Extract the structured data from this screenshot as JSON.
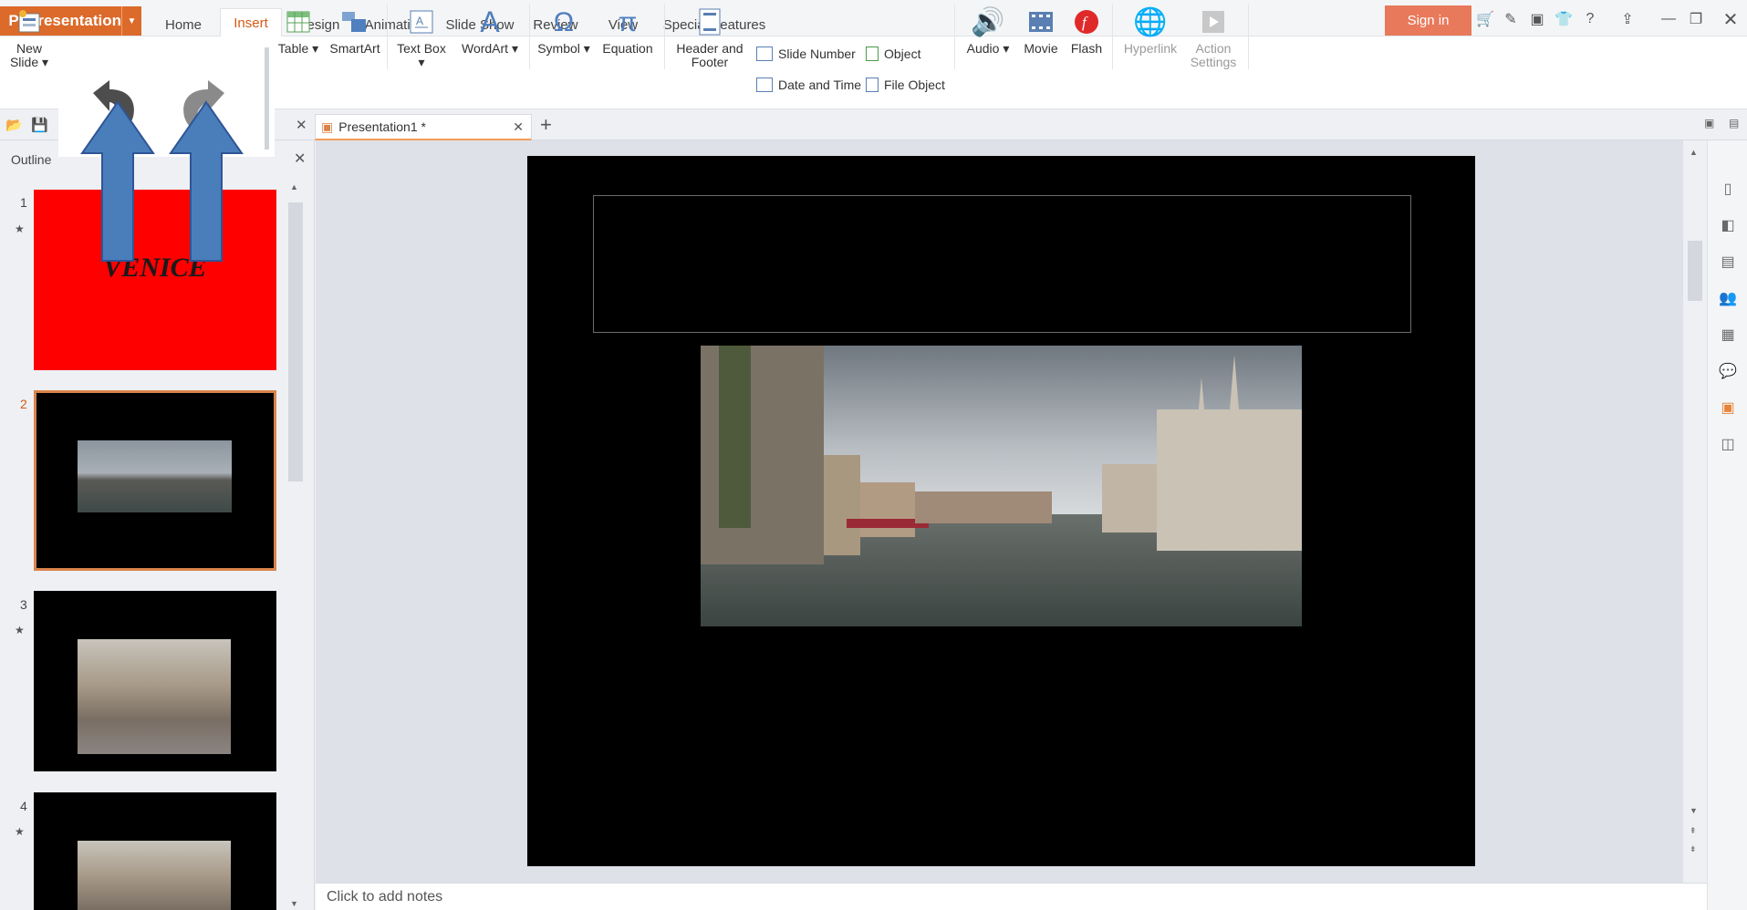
{
  "app": {
    "name": "Presentation",
    "logo_glyph": "P"
  },
  "menu_tabs": [
    "Home",
    "Insert",
    "Design",
    "Animation",
    "Slide Show",
    "Review",
    "View",
    "Special Features"
  ],
  "active_tab": "Insert",
  "sign_in": "Sign in",
  "ribbon": {
    "new_slide": "New",
    "new_slide_2": "Slide",
    "table": "Table",
    "smartart": "SmartArt",
    "text_box": "Text Box",
    "wordart": "WordArt",
    "symbol": "Symbol",
    "equation": "Equation",
    "header_footer_1": "Header and",
    "header_footer_2": "Footer",
    "slide_number": "Slide Number",
    "date_time": "Date and Time",
    "object": "Object",
    "file_object": "File Object",
    "audio": "Audio",
    "movie": "Movie",
    "flash": "Flash",
    "hyperlink": "Hyperlink",
    "action_settings_1": "Action",
    "action_settings_2": "Settings"
  },
  "document_tab": "Presentation1 *",
  "panel": {
    "outline_tab": "Outline"
  },
  "slides": [
    {
      "number": "1",
      "title_text": "VENICE"
    },
    {
      "number": "2"
    },
    {
      "number": "3"
    },
    {
      "number": "4"
    }
  ],
  "notes_placeholder": "Click to add notes",
  "colors": {
    "accent": "#dc6a2a",
    "sign_in_bg": "#e8795b",
    "active_tab_text": "#d35b14",
    "slide1_bg": "#ff0000",
    "arrow_fill": "#4a7ebb",
    "arrow_stroke": "#2f5597"
  },
  "icons": [
    "undo-icon",
    "redo-icon",
    "cart-icon",
    "skin-icon",
    "help-icon",
    "minimize-icon",
    "restore-icon",
    "close-icon"
  ]
}
